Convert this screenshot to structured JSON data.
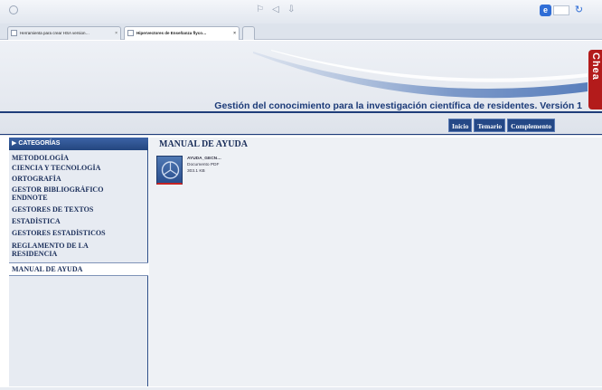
{
  "browser": {
    "toolbar_icons": "⚐ ◁ ⇩ ✧",
    "logo": "e",
    "refresh_icon": "↻",
    "tabs": [
      {
        "label": "Herramienta para crear HSA version…",
        "close": "×"
      },
      {
        "label": "Hipervectores de Enseñanza flyco…",
        "close": "×"
      }
    ]
  },
  "header": {
    "badge_text": "Chea",
    "site_title": "Gestión del conocimiento para la investigación científica de residentes. Versión 1",
    "nav": [
      "Inicio",
      "Temario",
      "Complemento"
    ]
  },
  "sidebar": {
    "header": "▶ CATEGORÍAS",
    "items": [
      {
        "label": "METODOLOGÍA"
      },
      {
        "label": "CIENCIA Y TECNOLOGÍA"
      },
      {
        "label": "ORTOGRAFÍA"
      },
      {
        "label": "GESTOR BIBLIOGRÁFICO ENDNOTE"
      },
      {
        "label": "GESTORES DE TEXTOS"
      },
      {
        "label": "ESTADÍSTICA"
      },
      {
        "label": "GESTORES ESTADÍSTICOS"
      },
      {
        "label": "REGLAMENTO DE LA RESIDENCIA"
      },
      {
        "label": "MANUAL DE AYUDA"
      }
    ]
  },
  "main": {
    "title": "MANUAL DE AYUDA",
    "document": {
      "name": "AYUDA_GECN…",
      "type": "Documento PDF",
      "size": "303.1 KB"
    }
  }
}
